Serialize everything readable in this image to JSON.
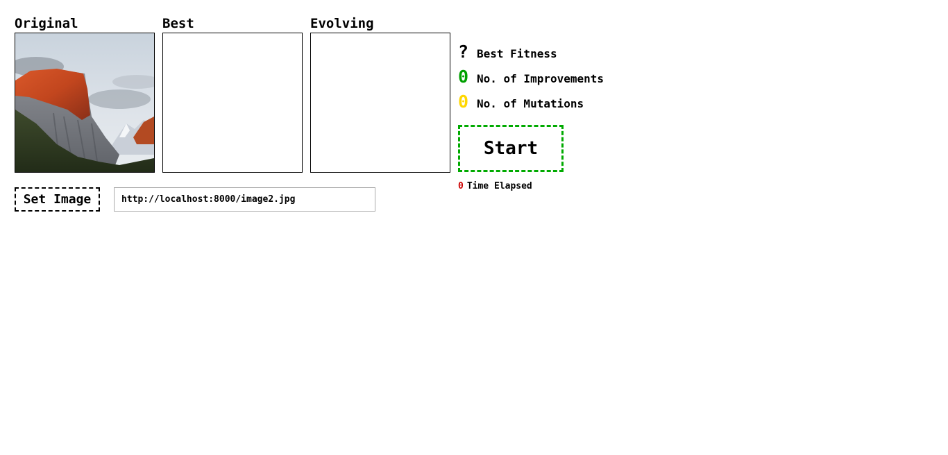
{
  "panels": {
    "original_label": "Original",
    "best_label": "Best",
    "evolving_label": "Evolving"
  },
  "stats": {
    "best_fitness": {
      "value": "?",
      "label": "Best Fitness",
      "color": "#000000"
    },
    "improvements": {
      "value": "0",
      "label": "No. of Improvements",
      "color": "#00a000"
    },
    "mutations": {
      "value": "0",
      "label": "No. of Mutations",
      "color": "#ffd700"
    }
  },
  "controls": {
    "start_label": "Start",
    "set_image_label": "Set Image",
    "url_value": "http://localhost:8000/image2.jpg"
  },
  "time": {
    "value": "0",
    "label": "Time Elapsed"
  },
  "colors": {
    "start_border": "#00aa00",
    "time_value": "#cc0000"
  }
}
